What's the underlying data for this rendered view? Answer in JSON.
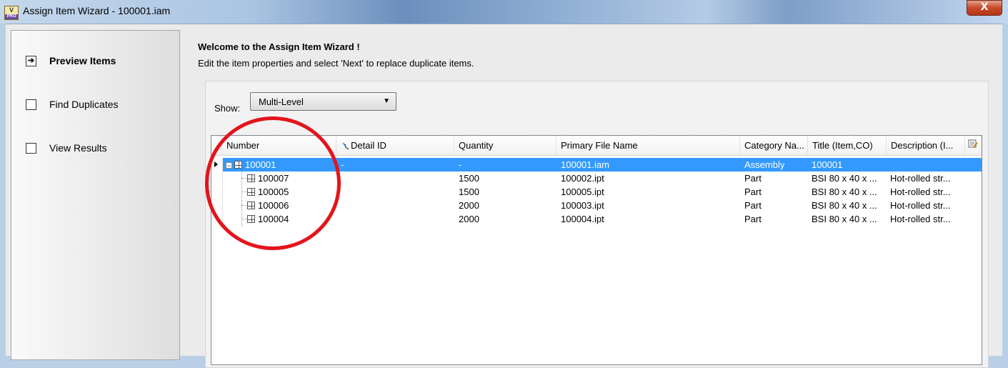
{
  "window": {
    "title": "Assign Item Wizard - 100001.iam",
    "icon_text": "V",
    "icon_sub": "PRO",
    "close_label": "X"
  },
  "steps": [
    {
      "label": "Preview Items",
      "active": true,
      "icon": "arrow-right-icon",
      "glyph": "➔"
    },
    {
      "label": "Find Duplicates",
      "active": false,
      "icon": "checkbox-icon",
      "glyph": ""
    },
    {
      "label": "View Results",
      "active": false,
      "icon": "checkbox-icon",
      "glyph": ""
    }
  ],
  "header": {
    "welcome": "Welcome to the Assign Item Wizard !",
    "instructions": "Edit the item properties and select 'Next' to replace duplicate items."
  },
  "show": {
    "label": "Show:",
    "value": "Multi-Level"
  },
  "grid": {
    "columns": [
      "Number",
      "Detail ID",
      "Quantity",
      "Primary File Name",
      "Category Na...",
      "Title (Item,CO)",
      "Description (I..."
    ],
    "rows": [
      {
        "number": "100001",
        "detail_id": "-",
        "quantity": "-",
        "file": "100001.iam",
        "category": "Assembly",
        "title": "100001",
        "description": "",
        "selected": true,
        "level": 0
      },
      {
        "number": "100007",
        "detail_id": "",
        "quantity": "1500",
        "file": "100002.ipt",
        "category": "Part",
        "title": "BSI 80 x 40 x ...",
        "description": "Hot-rolled str...",
        "selected": false,
        "level": 1
      },
      {
        "number": "100005",
        "detail_id": "",
        "quantity": "1500",
        "file": "100005.ipt",
        "category": "Part",
        "title": "BSI 80 x 40 x ...",
        "description": "Hot-rolled str...",
        "selected": false,
        "level": 1
      },
      {
        "number": "100006",
        "detail_id": "",
        "quantity": "2000",
        "file": "100003.ipt",
        "category": "Part",
        "title": "BSI 80 x 40 x ...",
        "description": "Hot-rolled str...",
        "selected": false,
        "level": 1
      },
      {
        "number": "100004",
        "detail_id": "",
        "quantity": "2000",
        "file": "100004.ipt",
        "category": "Part",
        "title": "BSI 80 x 40 x ...",
        "description": "Hot-rolled str...",
        "selected": false,
        "level": 1
      }
    ]
  },
  "colors": {
    "selection": "#3399ff",
    "annotation_circle": "#e4141b"
  }
}
